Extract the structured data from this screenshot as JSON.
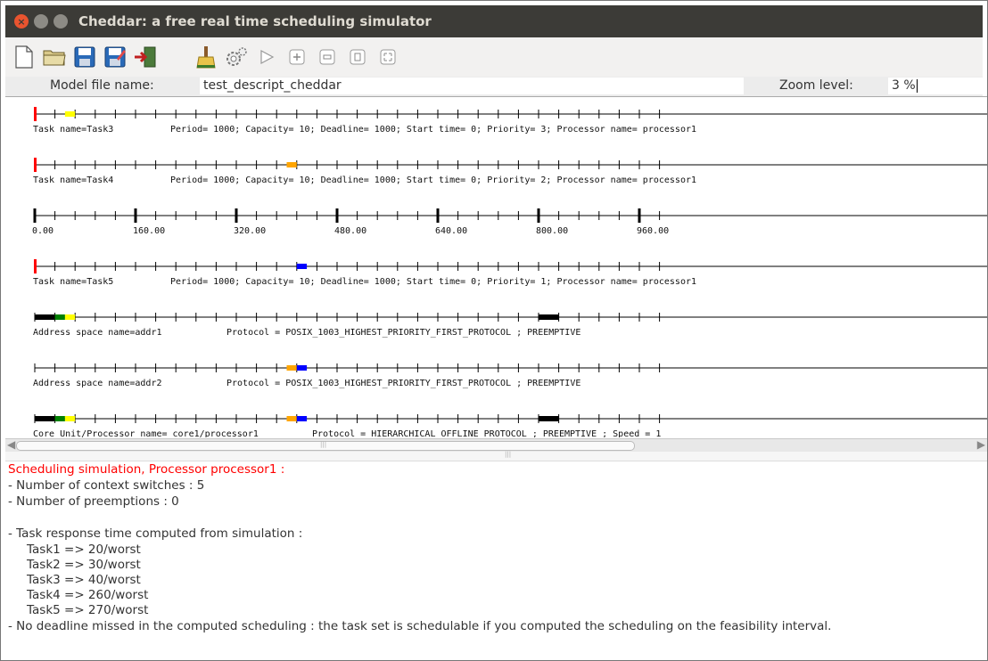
{
  "window": {
    "title": "Cheddar: a free real time scheduling simulator"
  },
  "toolbar": {
    "buttons": [
      "new-file-icon",
      "open-folder-icon",
      "save-icon",
      "save-as-icon",
      "exit-icon",
      "clear-icon",
      "settings-icon",
      "run-icon",
      "zoom-in-icon",
      "zoom-out-icon",
      "zoom-reset-icon",
      "zoom-fit-icon"
    ]
  },
  "model": {
    "file_label": "Model file name:",
    "file_value": "test_descript_cheddar",
    "zoom_label": "Zoom level:",
    "zoom_value": "3 %"
  },
  "colors": {
    "deadline": "#ff0000",
    "task3": "#ffff00",
    "task4": "#ffa500",
    "task5": "#0000ff",
    "black": "#000000",
    "green": "#008000"
  },
  "timeline": {
    "rows": [
      {
        "kind": "task",
        "label": "Task name=Task3",
        "details": "Period= 1000; Capacity= 10; Deadline= 1000; Start time= 0; Priority= 3; Processor name= processor1"
      },
      {
        "kind": "task",
        "label": "Task name=Task4",
        "details": "Period= 1000; Capacity= 10; Deadline= 1000; Start time= 0; Priority= 2; Processor name= processor1"
      },
      {
        "kind": "axis",
        "ticks": [
          "0.00",
          "160.00",
          "320.00",
          "480.00",
          "640.00",
          "800.00",
          "960.00"
        ]
      },
      {
        "kind": "task",
        "label": "Task name=Task5",
        "details": "Period= 1000; Capacity= 10; Deadline= 1000; Start time= 0; Priority= 1; Processor name= processor1"
      },
      {
        "kind": "space",
        "label": "Address space name=addr1",
        "details": "Protocol = POSIX_1003_HIGHEST_PRIORITY_FIRST_PROTOCOL ; PREEMPTIVE"
      },
      {
        "kind": "space",
        "label": "Address space name=addr2",
        "details": "Protocol = POSIX_1003_HIGHEST_PRIORITY_FIRST_PROTOCOL ; PREEMPTIVE"
      },
      {
        "kind": "core",
        "label": "Core Unit/Processor name= core1/processor1",
        "details": "Protocol = HIERARCHICAL_OFFLINE_PROTOCOL ; PREEMPTIVE ; Speed =  1"
      }
    ]
  },
  "output": {
    "heading": "Scheduling simulation, Processor processor1 :",
    "context_switches": "- Number of context switches :  5",
    "preemptions": "- Number of preemptions :  0",
    "response_heading": "- Task response time computed from simulation :",
    "responses": [
      "Task1 => 20/worst",
      "Task2 => 30/worst",
      "Task3 => 40/worst",
      "Task4 => 260/worst",
      "Task5 => 270/worst"
    ],
    "conclusion": "- No deadline missed in the computed scheduling : the task set is schedulable if you computed the scheduling on the feasibility interval."
  }
}
